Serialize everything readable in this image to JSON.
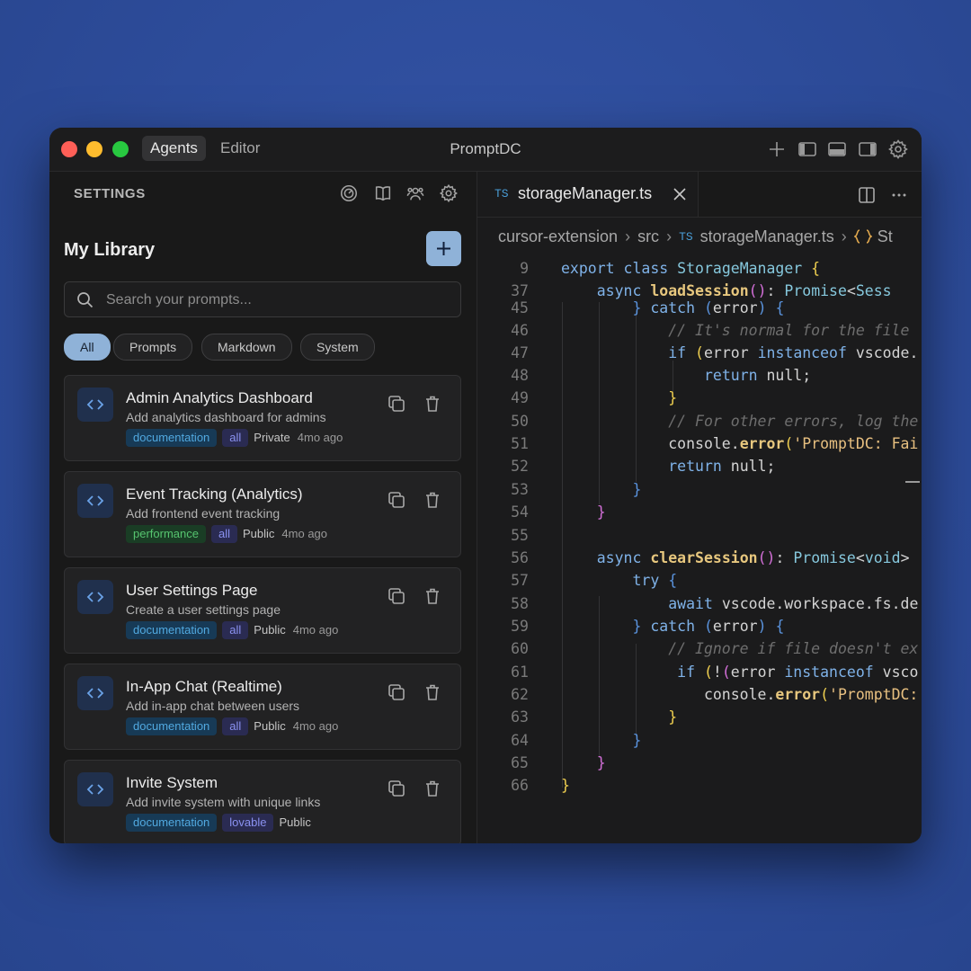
{
  "titlebar": {
    "tabs": [
      "Agents",
      "Editor"
    ],
    "active_tab": "Agents",
    "app_title": "PromptDC"
  },
  "sidebar": {
    "section_title": "SETTINGS",
    "library_title": "My Library",
    "search": {
      "placeholder": "Search your prompts...",
      "value": ""
    },
    "filters": [
      "All",
      "Prompts",
      "Markdown",
      "System"
    ],
    "active_filter": "All",
    "cards": [
      {
        "title": "Admin Analytics Dashboard",
        "description": "Add analytics dashboard for admins",
        "tag": "documentation",
        "tag_type": "doc",
        "source": "all",
        "visibility": "Private",
        "time": "4mo ago"
      },
      {
        "title": "Event Tracking (Analytics)",
        "description": "Add frontend event tracking",
        "tag": "performance",
        "tag_type": "perf",
        "source": "all",
        "visibility": "Public",
        "time": "4mo ago"
      },
      {
        "title": "User Settings Page",
        "description": "Create a user settings page",
        "tag": "documentation",
        "tag_type": "doc",
        "source": "all",
        "visibility": "Public",
        "time": "4mo ago"
      },
      {
        "title": "In-App Chat (Realtime)",
        "description": "Add in-app chat between users",
        "tag": "documentation",
        "tag_type": "doc",
        "source": "all",
        "visibility": "Public",
        "time": "4mo ago"
      },
      {
        "title": "Invite System",
        "description": "Add invite system with unique links",
        "tag": "documentation",
        "tag_type": "doc",
        "source": "lovable",
        "visibility": "Public",
        "time": ""
      }
    ]
  },
  "editor": {
    "tab_badge": "TS",
    "tab_label": "storageManager.ts",
    "breadcrumbs": [
      "cursor-extension",
      "src",
      "storageManager.ts",
      "St"
    ],
    "code_lines": [
      {
        "n": "9",
        "tokens": [
          [
            "k",
            "export "
          ],
          [
            "k",
            "class "
          ],
          [
            "t",
            "StorageManager "
          ],
          [
            "y",
            "{"
          ]
        ]
      },
      {
        "n": "37",
        "tokens": [
          [
            "p",
            "    "
          ],
          [
            "k",
            "async "
          ],
          [
            "f",
            "loadSession"
          ],
          [
            "m",
            "()"
          ],
          [
            "p",
            ": "
          ],
          [
            "t",
            "Promise"
          ],
          [
            "p",
            "<"
          ],
          [
            "t",
            "Sess"
          ]
        ]
      },
      {
        "n": "45",
        "tokens": [
          [
            "p",
            "        "
          ],
          [
            "b",
            "} "
          ],
          [
            "k",
            "catch "
          ],
          [
            "b",
            "("
          ],
          [
            "p",
            "error"
          ],
          [
            "b",
            ") {"
          ]
        ]
      },
      {
        "n": "46",
        "tokens": [
          [
            "c",
            "            // It's normal for the file"
          ]
        ]
      },
      {
        "n": "47",
        "tokens": [
          [
            "p",
            "            "
          ],
          [
            "k",
            "if "
          ],
          [
            "y",
            "("
          ],
          [
            "p",
            "error "
          ],
          [
            "k",
            "instanceof "
          ],
          [
            "p",
            "vscode."
          ]
        ]
      },
      {
        "n": "48",
        "tokens": [
          [
            "p",
            "                "
          ],
          [
            "k",
            "return "
          ],
          [
            "p",
            "null;"
          ]
        ]
      },
      {
        "n": "49",
        "tokens": [
          [
            "y",
            "            }"
          ]
        ]
      },
      {
        "n": "50",
        "tokens": [
          [
            "c",
            "            // For other errors, log the"
          ]
        ]
      },
      {
        "n": "51",
        "tokens": [
          [
            "p",
            "            console."
          ],
          [
            "f",
            "error"
          ],
          [
            "y",
            "("
          ],
          [
            "s",
            "'PromptDC: Fai"
          ]
        ]
      },
      {
        "n": "52",
        "tokens": [
          [
            "p",
            "            "
          ],
          [
            "k",
            "return "
          ],
          [
            "p",
            "null;"
          ]
        ]
      },
      {
        "n": "53",
        "tokens": [
          [
            "b",
            "        }"
          ]
        ]
      },
      {
        "n": "54",
        "tokens": [
          [
            "m",
            "    }"
          ]
        ]
      },
      {
        "n": "55",
        "tokens": []
      },
      {
        "n": "56",
        "tokens": [
          [
            "p",
            "    "
          ],
          [
            "k",
            "async "
          ],
          [
            "f",
            "clearSession"
          ],
          [
            "m",
            "()"
          ],
          [
            "p",
            ": "
          ],
          [
            "t",
            "Promise"
          ],
          [
            "p",
            "<"
          ],
          [
            "t",
            "void"
          ],
          [
            "p",
            "> "
          ]
        ]
      },
      {
        "n": "57",
        "tokens": [
          [
            "p",
            "        "
          ],
          [
            "k",
            "try "
          ],
          [
            "b",
            "{"
          ]
        ]
      },
      {
        "n": "58",
        "tokens": [
          [
            "p",
            "            "
          ],
          [
            "k",
            "await "
          ],
          [
            "p",
            "vscode.workspace.fs.de"
          ]
        ]
      },
      {
        "n": "59",
        "tokens": [
          [
            "p",
            "        "
          ],
          [
            "b",
            "} "
          ],
          [
            "k",
            "catch "
          ],
          [
            "b",
            "("
          ],
          [
            "p",
            "error"
          ],
          [
            "b",
            ") {"
          ]
        ]
      },
      {
        "n": "60",
        "tokens": [
          [
            "c",
            "            // Ignore if file doesn't ex"
          ]
        ]
      },
      {
        "n": "61",
        "tokens": [
          [
            "p",
            "             "
          ],
          [
            "k",
            "if "
          ],
          [
            "y",
            "("
          ],
          [
            "p",
            "!"
          ],
          [
            "m",
            "("
          ],
          [
            "p",
            "error "
          ],
          [
            "k",
            "instanceof "
          ],
          [
            "p",
            "vsco"
          ]
        ]
      },
      {
        "n": "62",
        "tokens": [
          [
            "p",
            "                console."
          ],
          [
            "f",
            "error"
          ],
          [
            "y",
            "("
          ],
          [
            "s",
            "'PromptDC:"
          ]
        ]
      },
      {
        "n": "63",
        "tokens": [
          [
            "y",
            "            }"
          ]
        ]
      },
      {
        "n": "64",
        "tokens": [
          [
            "b",
            "        }"
          ]
        ]
      },
      {
        "n": "65",
        "tokens": [
          [
            "m",
            "    }"
          ]
        ]
      },
      {
        "n": "66",
        "tokens": [
          [
            "y",
            "}"
          ]
        ]
      }
    ]
  },
  "colors": {
    "accent": "#8fb2d8",
    "doc_tag": "#51a9e0",
    "perf_tag": "#56c46f",
    "source_tag": "#8a91f0"
  },
  "icons": [
    "plus-icon",
    "sidebar-left-icon",
    "panel-bottom-icon",
    "sidebar-right-icon",
    "gear-icon",
    "gauge-icon",
    "book-icon",
    "users-icon",
    "code-icon",
    "copy-icon",
    "trash-icon",
    "search-icon",
    "close-icon",
    "split-icon",
    "more-icon",
    "chevron-right-icon",
    "braces-icon"
  ]
}
